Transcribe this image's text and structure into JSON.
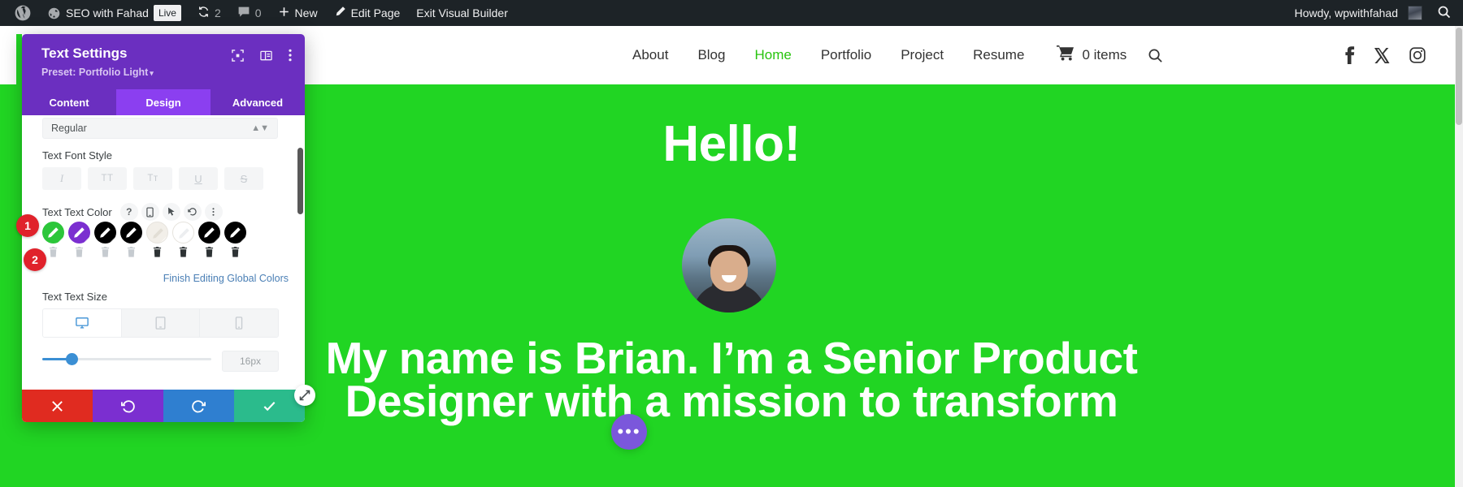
{
  "adminbar": {
    "wp_logo_icon": "wordpress-logo-icon",
    "site_name": "SEO with Fahad",
    "site_icon": "dashboard-icon",
    "live_badge": "Live",
    "updates_icon": "updates-icon",
    "updates_count": "2",
    "comments_icon": "comment-bubble-icon",
    "comments_count": "0",
    "new_icon": "plus-icon",
    "new_label": "New",
    "edit_icon": "pencil-icon",
    "edit_label": "Edit Page",
    "exit_label": "Exit Visual Builder",
    "howdy": "Howdy, wpwithfahad",
    "avatar_icon": "user-avatar",
    "search_icon": "search-icon"
  },
  "site": {
    "nav": {
      "items": [
        {
          "label": "About",
          "active": false
        },
        {
          "label": "Blog",
          "active": false
        },
        {
          "label": "Home",
          "active": true
        },
        {
          "label": "Portfolio",
          "active": false
        },
        {
          "label": "Project",
          "active": false
        },
        {
          "label": "Resume",
          "active": false
        }
      ],
      "cart_icon": "shopping-cart-icon",
      "cart_label": "0 items",
      "search_icon": "search-icon",
      "social": [
        {
          "name": "facebook-icon"
        },
        {
          "name": "x-twitter-icon"
        },
        {
          "name": "instagram-icon"
        }
      ]
    },
    "hero": {
      "heading": "Hello!",
      "avatar_icon": "profile-photo",
      "line1": "My name is Brian. I’m a Senior Product",
      "line2": "Designer with a mission to transform",
      "bg_color": "#21d523"
    },
    "fab_label": "•••"
  },
  "divi": {
    "title": "Text Settings",
    "preset_label": "Preset: Portfolio Light",
    "preset_caret": "▾",
    "head_icons": [
      {
        "name": "focus-target-icon"
      },
      {
        "name": "layout-columns-icon"
      },
      {
        "name": "kebab-menu-icon"
      }
    ],
    "tabs": [
      {
        "label": "Content",
        "active": false
      },
      {
        "label": "Design",
        "active": true
      },
      {
        "label": "Advanced",
        "active": false
      }
    ],
    "font_weight_value": "Regular",
    "font_style": {
      "label": "Text Font Style",
      "buttons": [
        {
          "name": "italic-button",
          "glyph": "I"
        },
        {
          "name": "uppercase-button",
          "glyph": "TT"
        },
        {
          "name": "small-caps-button",
          "glyph": "Tᴛ"
        },
        {
          "name": "underline-button",
          "glyph": "U"
        },
        {
          "name": "strikethrough-button",
          "glyph": "S"
        }
      ]
    },
    "text_color": {
      "label": "Text Text Color",
      "icons": [
        {
          "name": "help-icon",
          "glyph": "?"
        },
        {
          "name": "responsive-phone-icon"
        },
        {
          "name": "hover-cursor-icon"
        },
        {
          "name": "reset-icon"
        },
        {
          "name": "options-kebab-icon"
        }
      ],
      "swatches": [
        {
          "color": "#2cc63a",
          "light": false
        },
        {
          "color": "#7b2fd0",
          "light": false
        },
        {
          "color": "#000000",
          "light": false
        },
        {
          "color": "#000000",
          "light": false
        },
        {
          "color": "#f2efe9",
          "light": true
        },
        {
          "color": "#ffffff",
          "light": true
        },
        {
          "color": "#000000",
          "light": false
        },
        {
          "color": "#000000",
          "light": false
        }
      ],
      "delete_icon": "trash-icon",
      "finish_link": "Finish Editing Global Colors"
    },
    "text_size": {
      "label": "Text Text Size",
      "devices": [
        {
          "name": "desktop-icon",
          "active": true
        },
        {
          "name": "tablet-icon",
          "active": false
        },
        {
          "name": "phone-icon",
          "active": false
        }
      ],
      "value": "16px"
    },
    "footer": [
      {
        "name": "cancel-button",
        "icon": "close-x-icon",
        "color": "#e02b20"
      },
      {
        "name": "undo-button",
        "icon": "undo-arrow-icon",
        "color": "#7b2fd0"
      },
      {
        "name": "redo-button",
        "icon": "redo-arrow-icon",
        "color": "#2f7fd0"
      },
      {
        "name": "save-button",
        "icon": "check-icon",
        "color": "#2bbb8c"
      }
    ],
    "resize_icon": "resize-handle-icon",
    "callouts": [
      {
        "number": "1"
      },
      {
        "number": "2"
      }
    ]
  }
}
